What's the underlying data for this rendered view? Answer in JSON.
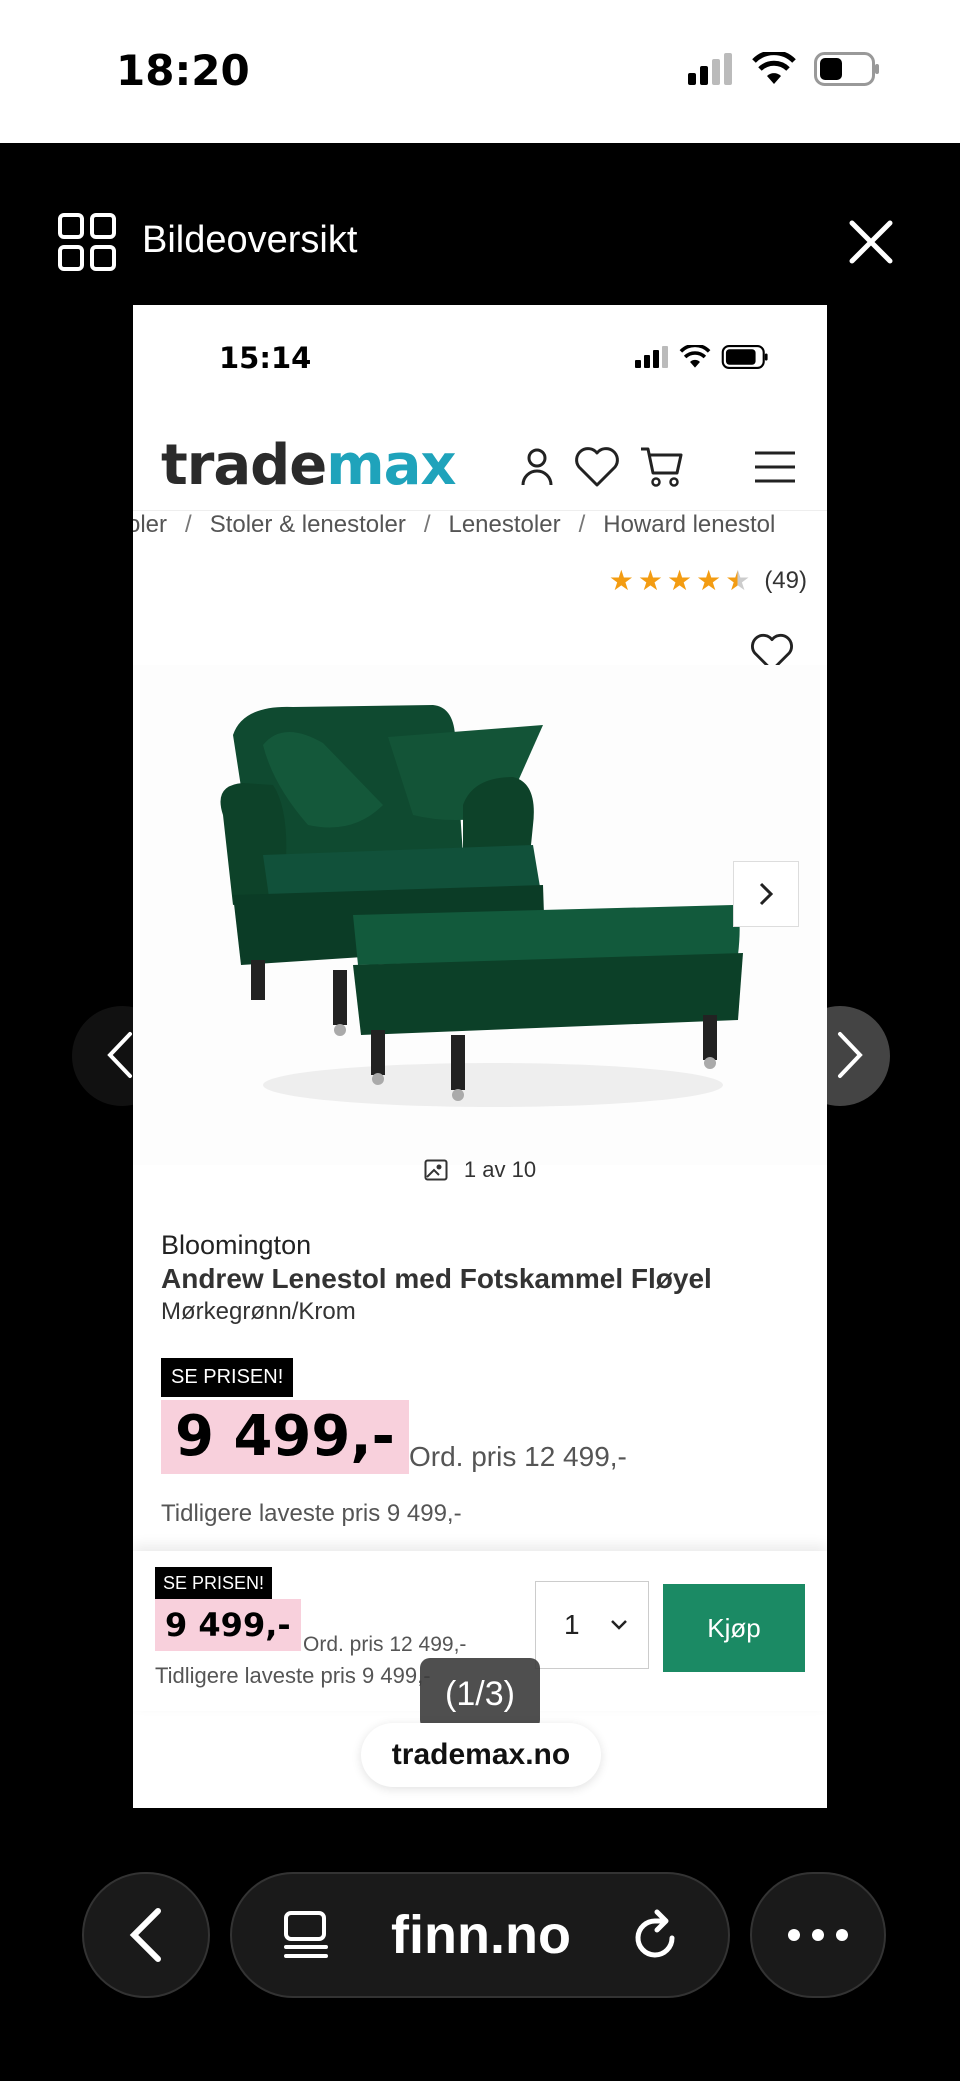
{
  "outer_status": {
    "time": "18:20"
  },
  "viewer": {
    "title": "Bildeoversikt",
    "page_counter": "(1/3)"
  },
  "inner_status": {
    "time": "15:14"
  },
  "site": {
    "logo_part1": "trade",
    "logo_part2": "max",
    "breadcrumb": [
      "oler",
      "Stoler & lenestoler",
      "Lenestoler",
      "Howard lenestol"
    ],
    "breadcrumb_sep": "/"
  },
  "product": {
    "rating_stars": 4.5,
    "rating_count": "(49)",
    "image_counter": "1 av 10",
    "brand": "Bloomington",
    "title": "Andrew Lenestol med Fotskammel Fløyel",
    "variant": "Mørkegrønn/Krom",
    "badge": "SE PRISEN!",
    "price": "9 499,-",
    "ordinary_price": "Ord. pris 12 499,-",
    "lowest_price": "Tidligere laveste pris 9 499,-"
  },
  "sticky": {
    "badge": "SE PRISEN!",
    "price": "9 499,-",
    "ordinary_price": "Ord. pris 12 499,-",
    "lowest_price": "Tidligere laveste pris 9 499,-",
    "quantity": "1",
    "buy_label": "Kjøp"
  },
  "domain_pill": "trademax.no",
  "toolbar": {
    "url": "finn.no"
  },
  "colors": {
    "brand_teal": "#1fa3bb",
    "buy_green": "#1b8a64",
    "price_pink": "#f8d0dc",
    "star": "#f39c12"
  }
}
